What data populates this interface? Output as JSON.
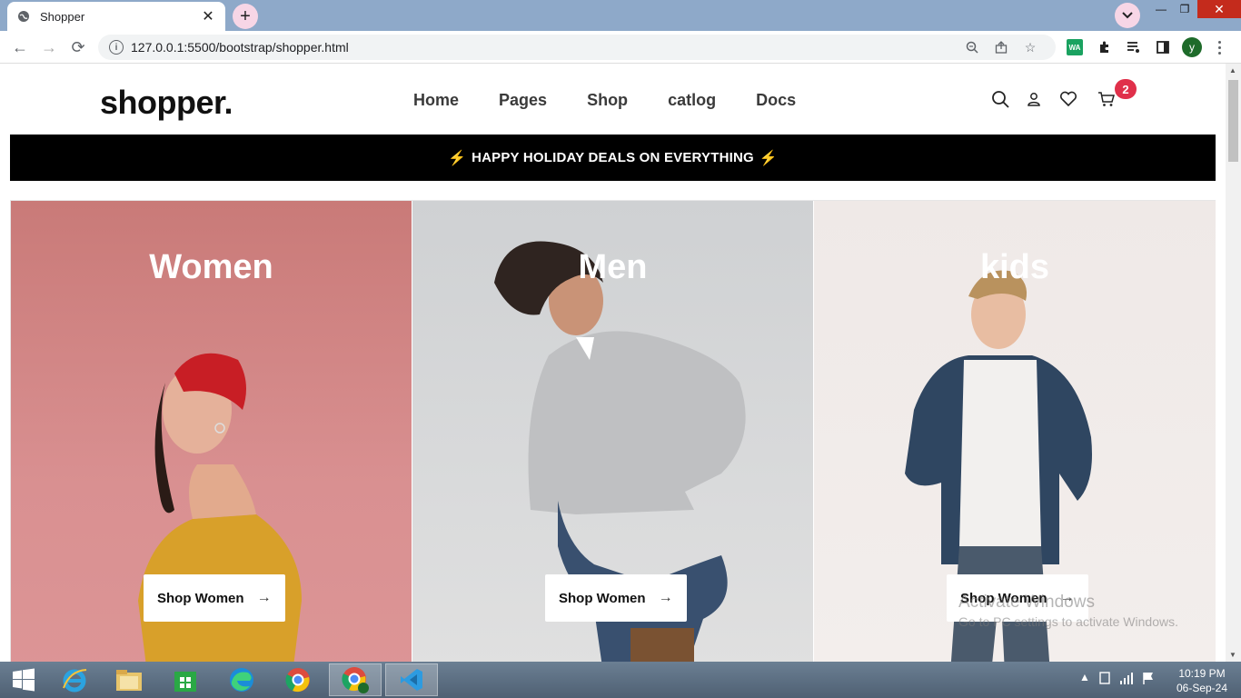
{
  "browser": {
    "tab_title": "Shopper",
    "url": "127.0.0.1:5500/bootstrap/shopper.html",
    "profile_initial": "y",
    "ext_wa_label": "WA"
  },
  "site": {
    "logo": "shopper.",
    "nav": [
      "Home",
      "Pages",
      "Shop",
      "catlog",
      "Docs"
    ],
    "cart_count": "2",
    "promo_text": "HAPPY HOLIDAY DEALS ON EVERYTHING",
    "promo_icon": "⚡"
  },
  "cards": [
    {
      "title": "Women",
      "button": "Shop Women",
      "bg": "#d48a89"
    },
    {
      "title": "Men",
      "button": "Shop Women",
      "bg": "#d6d7d8"
    },
    {
      "title": "kids",
      "button": "Shop Women",
      "bg": "#f1ebe9"
    }
  ],
  "watermark": {
    "line1": "Activate Windows",
    "line2": "Go to PC settings to activate Windows."
  },
  "taskbar": {
    "time": "10:19 PM",
    "date": "06-Sep-24"
  }
}
